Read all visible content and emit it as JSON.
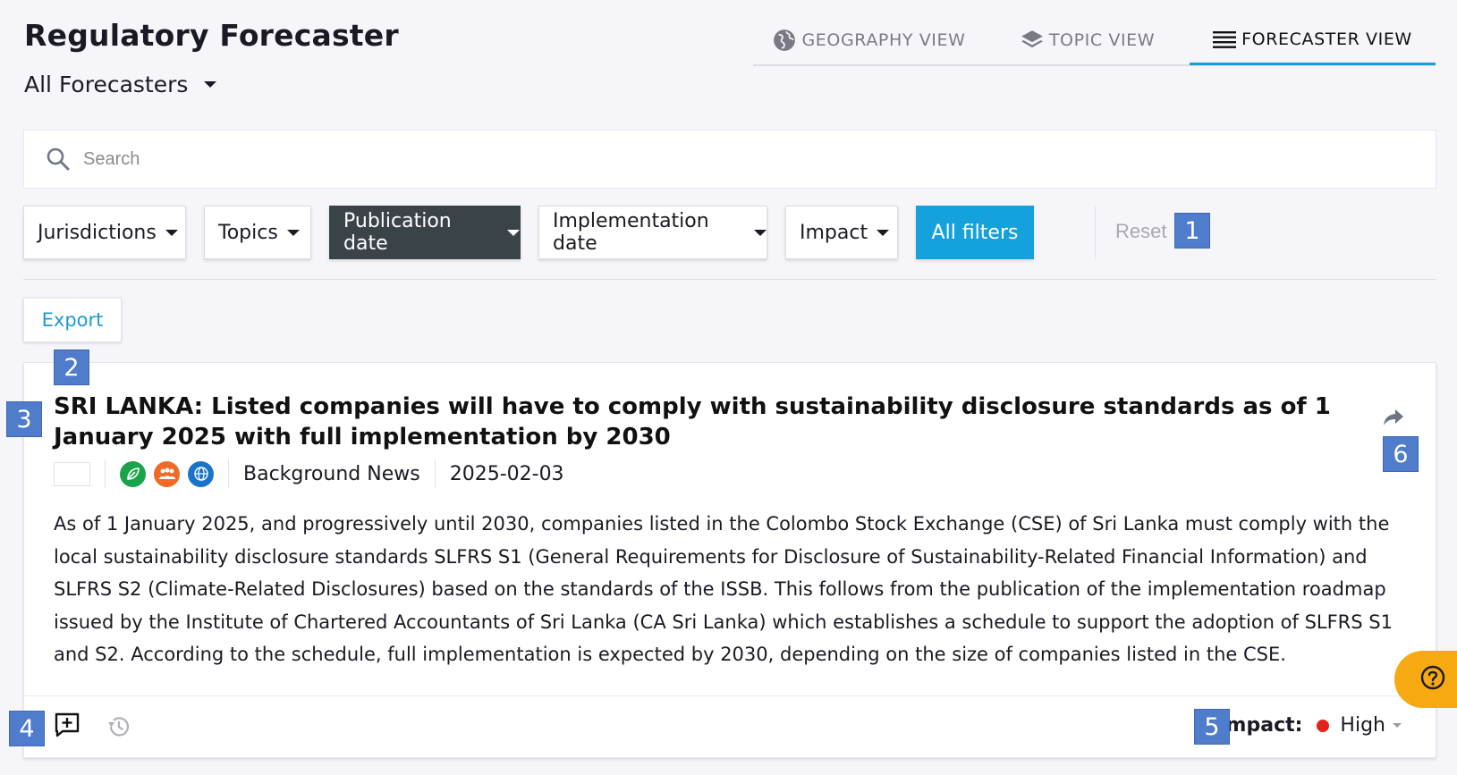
{
  "app": {
    "title": "Regulatory Forecaster"
  },
  "forecaster_select": {
    "value": "All Forecasters"
  },
  "view_tabs": [
    {
      "label": "GEOGRAPHY VIEW",
      "icon": "globe-icon",
      "active": false
    },
    {
      "label": "TOPIC VIEW",
      "icon": "layers-icon",
      "active": false
    },
    {
      "label": "FORECASTER VIEW",
      "icon": "list-icon",
      "active": true
    }
  ],
  "search": {
    "placeholder": "Search",
    "value": ""
  },
  "filters": {
    "jurisdictions": "Jurisdictions",
    "topics": "Topics",
    "publication_date": "Publication date",
    "implementation_date": "Implementation date",
    "impact": "Impact",
    "all_filters": "All filters",
    "reset": "Reset"
  },
  "export": {
    "label": "Export"
  },
  "card": {
    "title": "SRI LANKA: Listed companies will have to comply with sustainability disclosure standards as of 1 January 2025 with full implementation by 2030",
    "topic_icons": [
      "leaf-icon",
      "people-icon",
      "globe-network-icon"
    ],
    "category": "Background News",
    "date": "2025-02-03",
    "body": "As of 1 January 2025, and progressively until 2030, companies listed in the Colombo Stock Exchange (CSE) of Sri Lanka must comply with the local sustainability disclosure standards SLFRS S1 (General Requirements for Disclosure of Sustainability-Related Financial Information) and SLFRS S2 (Climate-Related Disclosures) based on the standards of the ISSB. This follows from the publication of the implementation roadmap issued by the Institute of Chartered Accountants of Sri Lanka (CA Sri Lanka) which establishes a schedule to support the adoption of SLFRS S1 and S2. According to the schedule, full implementation is expected by 2030, depending on the size of companies listed in the CSE.",
    "impact_label": "Impact:",
    "impact_value": "High"
  },
  "badges": [
    "1",
    "2",
    "3",
    "4",
    "5",
    "6"
  ],
  "colors": {
    "accent": "#15a1dc",
    "dark_button": "#3a4348",
    "impact_high": "#e2231a",
    "help": "#f6a911",
    "badge": "#4f7ccb"
  }
}
